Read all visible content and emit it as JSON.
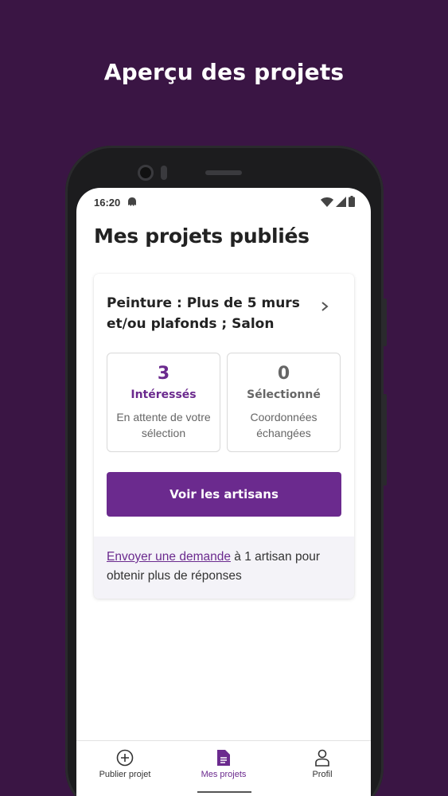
{
  "headline": "Aperçu des projets",
  "status_bar": {
    "time": "16:20"
  },
  "page_title": "Mes projets publiés",
  "project": {
    "title": "Peinture : Plus de 5 murs et/ou plafonds ; Salon",
    "stats": [
      {
        "value": "3",
        "label": "Intéressés",
        "sub": "En attente de votre sélection"
      },
      {
        "value": "0",
        "label": "Sélectionné",
        "sub": "Coordonnées échangées"
      }
    ],
    "cta_label": "Voir les artisans",
    "footer_link": "Envoyer une demande",
    "footer_text": " à 1 artisan pour obtenir plus de réponses"
  },
  "bottom_nav": {
    "items": [
      {
        "label": "Publier projet",
        "icon": "plus-circle-icon"
      },
      {
        "label": "Mes projets",
        "icon": "document-icon",
        "active": true
      },
      {
        "label": "Profil",
        "icon": "person-icon"
      }
    ]
  },
  "colors": {
    "background": "#3a1544",
    "accent": "#6b2a8e"
  }
}
